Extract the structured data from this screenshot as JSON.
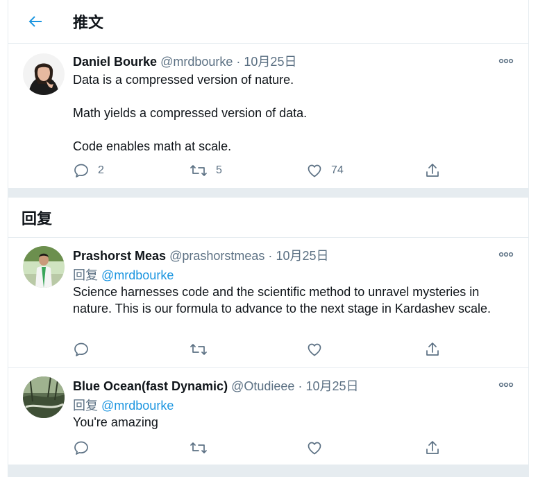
{
  "header": {
    "title": "推文",
    "back_icon": "arrow-left-icon"
  },
  "colors": {
    "accent": "#1b95e0",
    "secondary_text": "#5b7083",
    "separator": "#e6ecf0"
  },
  "main_tweet": {
    "author_name": "Daniel Bourke",
    "handle": "@mrdbourke",
    "separator": "·",
    "date": "10月25日",
    "paragraphs": [
      "Data is a compressed version of nature.",
      "Math yields a compressed version of data.",
      "Code enables math at scale."
    ],
    "reply_count": "2",
    "retweet_count": "5",
    "like_count": "74"
  },
  "replies_heading": "回复",
  "replies": [
    {
      "author_name": "Prashorst Meas",
      "handle": "@prashorstmeas",
      "separator": "·",
      "date": "10月25日",
      "reply_prefix": "回复",
      "reply_to": "@mrdbourke",
      "text": "Science harnesses code and the scientific method to unravel mysteries in nature. This is our formula to advance to the next stage in Kardashev scale."
    },
    {
      "author_name": "Blue Ocean(fast Dynamic)",
      "handle": "@Otudieee",
      "separator": "·",
      "date": "10月25日",
      "reply_prefix": "回复",
      "reply_to": "@mrdbourke",
      "text": "You're amazing"
    }
  ]
}
